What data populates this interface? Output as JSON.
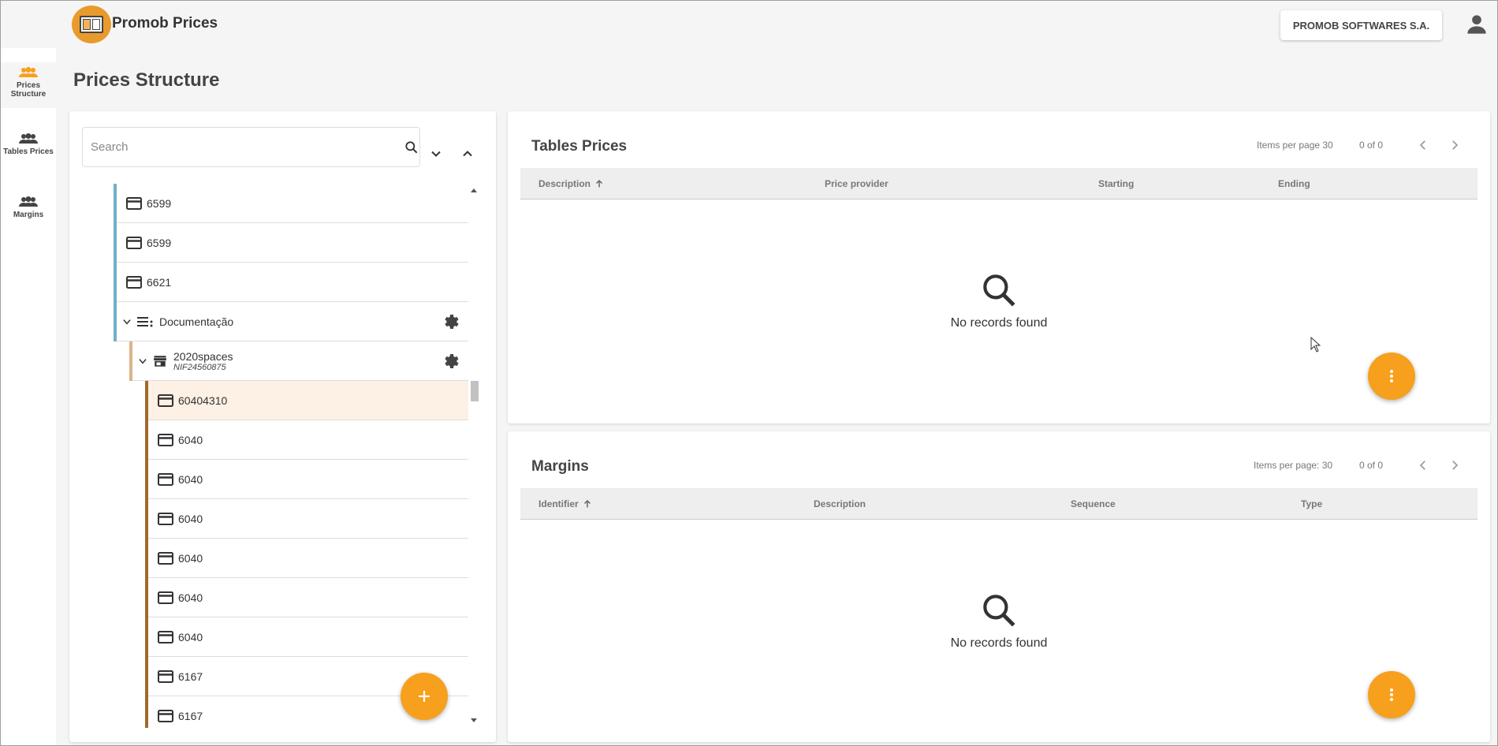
{
  "app": {
    "title": "Promob Prices",
    "company": "PROMOB SOFTWARES S.A."
  },
  "sidebar": {
    "items": [
      {
        "label": "Prices Structure",
        "active": true
      },
      {
        "label": "Tables Prices",
        "active": false
      },
      {
        "label": "Margins",
        "active": false
      }
    ]
  },
  "page": {
    "title": "Prices Structure"
  },
  "search": {
    "placeholder": "Search",
    "value": ""
  },
  "tree": {
    "rows": [
      {
        "label": "6599"
      },
      {
        "label": "6599"
      },
      {
        "label": "6621"
      },
      {
        "label": "Documentação"
      },
      {
        "label": "2020spaces",
        "sub": "NIF24560875"
      },
      {
        "label": "60404310"
      },
      {
        "label": "6040"
      },
      {
        "label": "6040"
      },
      {
        "label": "6040"
      },
      {
        "label": "6040"
      },
      {
        "label": "6040"
      },
      {
        "label": "6040"
      },
      {
        "label": "6167"
      },
      {
        "label": "6167"
      }
    ]
  },
  "tables_prices": {
    "title": "Tables Prices",
    "items_per_page": "Items per page 30",
    "range": "0 of 0",
    "columns": [
      "Description",
      "Price provider",
      "Starting",
      "Ending"
    ],
    "empty": "No records found"
  },
  "margins": {
    "title": "Margins",
    "items_per_page": "Items per page: 30",
    "range": "0 of 0",
    "columns": [
      "Identifier",
      "Description",
      "Sequence",
      "Type"
    ],
    "empty": "No records found"
  },
  "colors": {
    "accent": "#f7a01d",
    "level1_bar": "#6fb0c8",
    "level2_bar": "#d9b48a",
    "level3_bar": "#a0692a",
    "selected_row": "#fdf0e4"
  }
}
